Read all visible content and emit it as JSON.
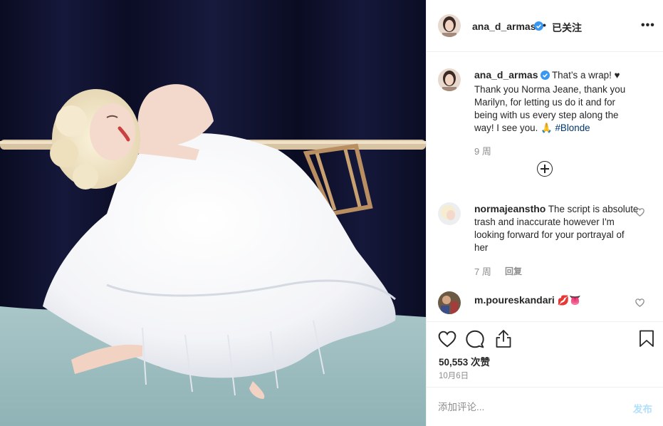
{
  "post": {
    "author": "ana_d_armas",
    "follow_status": "已关注",
    "more_label": "•••",
    "caption_author": "ana_d_armas",
    "caption_text": "That’s a wrap! ♥ Thank you Norma Jeane, thank you Marilyn, for letting us do it and for being with us every step along the way! I see you. 🙏",
    "caption_hashtag": "#Blonde",
    "caption_age": "9 周",
    "likes": "50,553 次赞",
    "date": "10月6日"
  },
  "comments": [
    {
      "user": "normajeanstho",
      "text": "The script is absolute trash and inaccurate however I'm looking forward for your portrayal of her",
      "age": "7 周",
      "reply_label": "回复"
    },
    {
      "user": "m.poureskandari",
      "text": "💋👅"
    }
  ],
  "add_comment": {
    "placeholder": "添加评论...",
    "post_label": "发布"
  },
  "icons": {
    "verified": "verified-badge-icon",
    "like": "heart-icon",
    "comment": "comment-bubble-icon",
    "share": "share-icon",
    "save": "bookmark-icon",
    "load_more": "plus-circle-icon"
  },
  "colors": {
    "verified_blue": "#3897f0",
    "hashtag": "#00376b",
    "muted": "#8e8e8e",
    "post_button_disabled": "#b2dffc"
  }
}
